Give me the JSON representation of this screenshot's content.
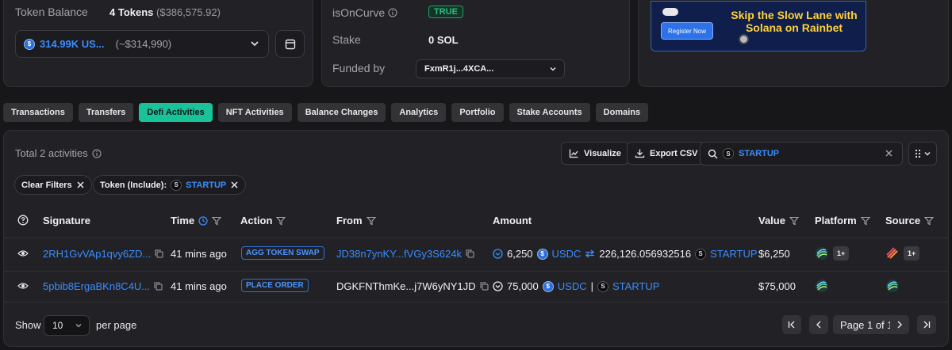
{
  "balance": {
    "label": "Token Balance",
    "tokens": "4 Tokens",
    "tokens_usd": "($386,575.92)",
    "selected_amount": "314.99K US...",
    "selected_usd": "(~$314,990)"
  },
  "account": {
    "is_on_curve_label": "isOnCurve",
    "is_on_curve_value": "TRUE",
    "stake_label": "Stake",
    "stake_value": "0 SOL",
    "funded_label": "Funded by",
    "funded_value": "FxmR1j...4XCA..."
  },
  "ad": {
    "headline": "Skip the Slow Lane with Solana on Rainbet",
    "cta": "Register Now"
  },
  "tabs": [
    {
      "label": "Transactions"
    },
    {
      "label": "Transfers"
    },
    {
      "label": "Defi Activities",
      "active": true
    },
    {
      "label": "NFT Activities"
    },
    {
      "label": "Balance Changes"
    },
    {
      "label": "Analytics"
    },
    {
      "label": "Portfolio"
    },
    {
      "label": "Stake Accounts"
    },
    {
      "label": "Domains"
    }
  ],
  "toolbar": {
    "total": "Total 2 activities",
    "visualize": "Visualize",
    "export": "Export CSV",
    "search_value": "STARTUP"
  },
  "filters": {
    "clear": "Clear Filters",
    "token_label": "Token (Include):",
    "token_value": "STARTUP"
  },
  "table": {
    "headers": {
      "signature": "Signature",
      "time": "Time",
      "action": "Action",
      "from": "From",
      "amount": "Amount",
      "value": "Value",
      "platform": "Platform",
      "source": "Source"
    },
    "rows": [
      {
        "signature": "2RH1GvVAp1qvy6ZD...",
        "time": "41 mins ago",
        "action": "AGG TOKEN SWAP",
        "from": "JD38n7ynKY...fVGy3S624k",
        "amount1": "6,250",
        "token1": "USDC",
        "amount2": "226,126.056932516",
        "token2": "STARTUP",
        "value": "$6,250",
        "platform_more": "1+",
        "source_more": "1+"
      },
      {
        "signature": "5pbib8ErgaBKn8C4U...",
        "time": "41 mins ago",
        "action": "PLACE ORDER",
        "from": "DGKFNThmKe...j7W6yNY1JD",
        "amount1": "75,000",
        "token1": "USDC",
        "separator": "|",
        "token2": "STARTUP",
        "value": "$75,000"
      }
    ]
  },
  "pagination": {
    "show": "Show",
    "page_size": "10",
    "per_page": "per page",
    "page_text": "Page 1 of 1"
  },
  "colors": {
    "accent": "#19c39a",
    "link": "#3a8dff",
    "background": "#17171a",
    "card": "#222226"
  }
}
